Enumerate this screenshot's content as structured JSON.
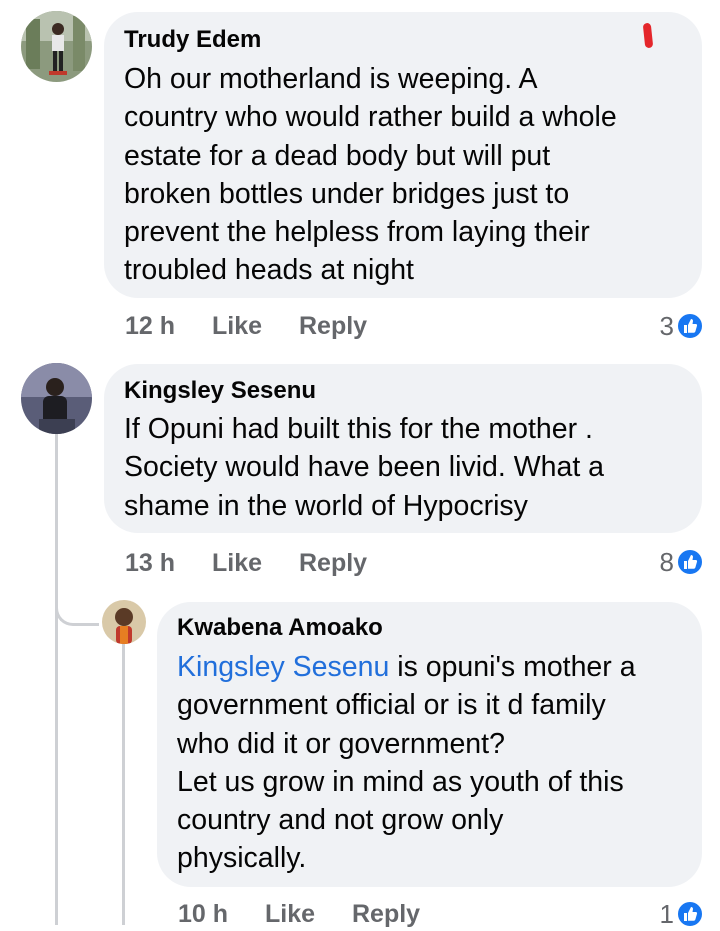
{
  "comments": [
    {
      "author": "Trudy Edem",
      "text": "Oh our motherland is weeping. A\ncountry who would rather build a whole\nestate for a dead body but will put\nbroken bottles under bridges just to\nprevent the helpless from laying their\ntroubled heads at night",
      "time": "12 h",
      "like_label": "Like",
      "reply_label": "Reply",
      "reactions": "3"
    },
    {
      "author": "Kingsley Sesenu",
      "text": "If Opuni had built this for the mother .\nSociety would have been livid. What a\nshame in the world of Hypocrisy",
      "time": "13 h",
      "like_label": "Like",
      "reply_label": "Reply",
      "reactions": "8"
    },
    {
      "author": "Kwabena Amoako",
      "mention": "Kingsley Sesenu",
      "text": " is opuni's mother a\ngovernment official or is it d family\nwho did it or government?\nLet us grow in mind as youth of this\ncountry and not grow only\nphysically.",
      "time": "10 h",
      "like_label": "Like",
      "reply_label": "Reply",
      "reactions": "1"
    }
  ],
  "icons": {
    "reaction": "like-thumb-icon",
    "marker": "red-flag-mark"
  },
  "colors": {
    "bubble": "#f0f2f5",
    "meta_text": "#65676b",
    "mention": "#216fdb",
    "like_badge": "#1877f2",
    "marker": "#e4262b"
  }
}
